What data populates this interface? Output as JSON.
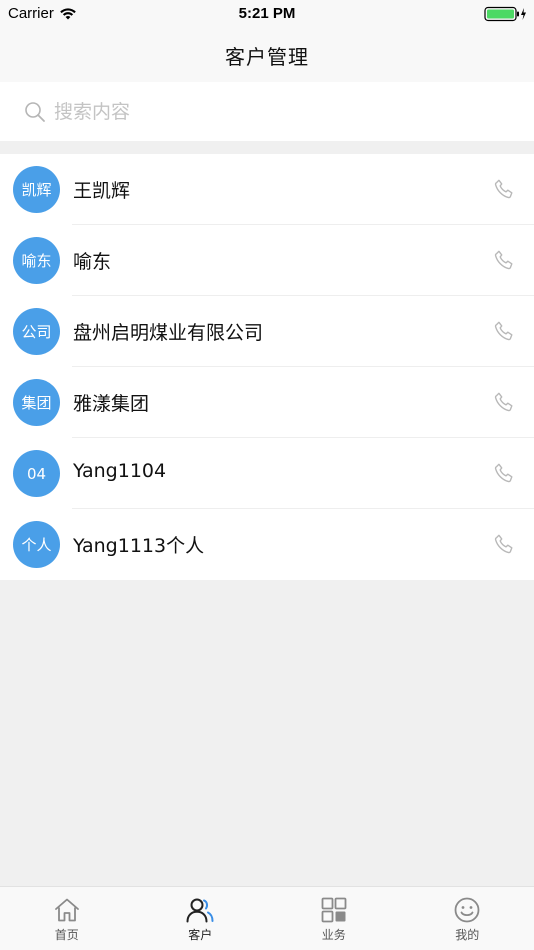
{
  "status_bar": {
    "carrier": "Carrier",
    "time": "5:21 PM"
  },
  "nav": {
    "title": "客户管理"
  },
  "search": {
    "placeholder": "搜索内容",
    "value": ""
  },
  "customers": [
    {
      "avatar": "凯辉",
      "name": "王凯辉"
    },
    {
      "avatar": "喻东",
      "name": "喻东"
    },
    {
      "avatar": "公司",
      "name": "盘州启明煤业有限公司"
    },
    {
      "avatar": "集团",
      "name": "雅漾集团"
    },
    {
      "avatar": "04",
      "name": "Yang1104"
    },
    {
      "avatar": "个人",
      "name": "Yang1113个人"
    }
  ],
  "tabs": [
    {
      "label": "首页",
      "icon": "home-icon",
      "active": false
    },
    {
      "label": "客户",
      "icon": "customers-icon",
      "active": true
    },
    {
      "label": "业务",
      "icon": "business-grid-icon",
      "active": false
    },
    {
      "label": "我的",
      "icon": "smiley-icon",
      "active": false
    }
  ],
  "colors": {
    "avatar_bg": "#4a9fe8",
    "battery_green": "#4cd964",
    "accent_blue": "#3a8ee6"
  }
}
